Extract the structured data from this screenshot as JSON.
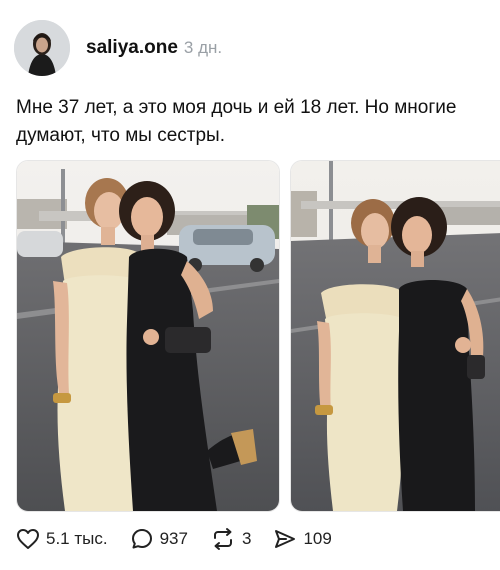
{
  "post": {
    "username": "saliya.one",
    "time": "3 дн.",
    "text": "Мне 37 лет, а это моя дочь и ей 18 лет. Но многие думают, что мы сестры."
  },
  "actions": {
    "likes": "5.1 тыс.",
    "comments": "937",
    "reposts": "3",
    "shares": "109"
  },
  "icons": {
    "like": "heart-icon",
    "comment": "speech-bubble-icon",
    "repost": "repost-arrows-icon",
    "share": "send-arrow-icon"
  }
}
